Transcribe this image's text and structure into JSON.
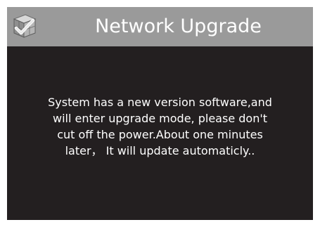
{
  "dialog": {
    "title": "Network Upgrade",
    "icon": "system-settings-check-icon",
    "message_lines": [
      "System has a new version software,and",
      "will enter upgrade mode, please don't",
      "cut off the power.About one minutes",
      "later， It will update automaticly.."
    ]
  },
  "colors": {
    "titlebar": "#9a9a9a",
    "background": "#231f20",
    "text": "#ffffff"
  }
}
